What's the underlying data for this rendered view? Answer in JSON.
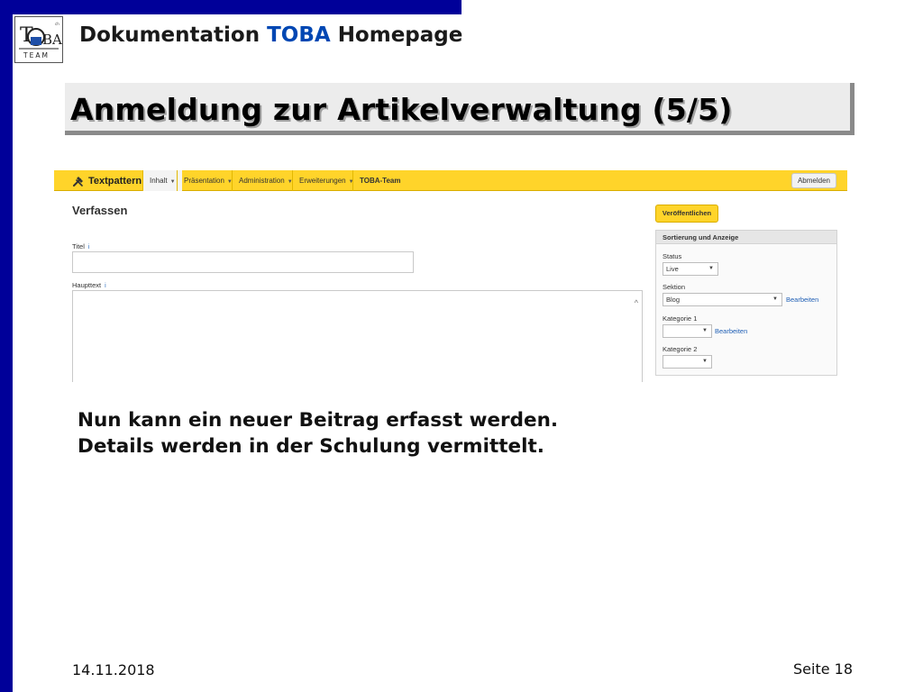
{
  "header": {
    "title_prefix": "Dokumentation",
    "title_accent": "TOBA",
    "title_suffix": "Homepage",
    "logo": {
      "top_text": "TOBA",
      "bottom_text": "TEAM"
    }
  },
  "slide": {
    "title": "Anmeldung zur Artikelverwaltung (5/5)",
    "body_lines": [
      "Nun kann ein neuer Beitrag erfasst werden.",
      "Details werden in der Schulung vermittelt."
    ]
  },
  "app": {
    "brand": "Textpattern",
    "nav": [
      {
        "label": "Inhalt"
      },
      {
        "label": "Präsentation"
      },
      {
        "label": "Administration"
      },
      {
        "label": "Erweiterungen"
      },
      {
        "label": "TOBA-Team"
      }
    ],
    "logout_label": "Abmelden",
    "compose_title": "Verfassen",
    "title_label": "Titel",
    "body_label": "Haupttext",
    "info_glyph": "i",
    "publish_label": "Veröffentlichen",
    "panel": {
      "heading": "Sortierung und Anzeige",
      "status_label": "Status",
      "status_value": "Live",
      "section_label": "Sektion",
      "section_value": "Blog",
      "edit_label": "Bearbeiten",
      "cat1_label": "Kategorie 1",
      "cat1_value": "",
      "cat2_label": "Kategorie 2",
      "cat2_value": ""
    }
  },
  "footer": {
    "date": "14.11.2018",
    "page": "Seite 18"
  },
  "colors": {
    "frame": "#000099",
    "accent": "#0047b3",
    "toolbar": "#ffd42a",
    "link": "#1f5fb5"
  }
}
